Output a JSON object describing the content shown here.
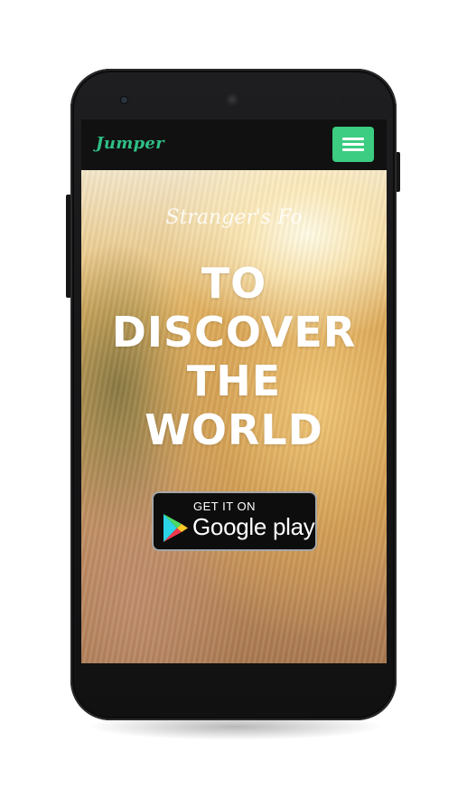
{
  "app": {
    "brand": "Jumper"
  },
  "hero": {
    "tagline": "Stranger's Fo",
    "headline_lines": [
      "TO",
      "DISCOVER",
      "THE",
      "WORLD"
    ]
  },
  "store_badge": {
    "small_text": "GET IT ON",
    "big_text": "Google play"
  },
  "colors": {
    "brand": "#2fbf86",
    "menu_button": "#3ccc82",
    "navbar": "#111111"
  },
  "icons": {
    "menu": "hamburger-icon",
    "play_logo": "google-play-logo"
  }
}
